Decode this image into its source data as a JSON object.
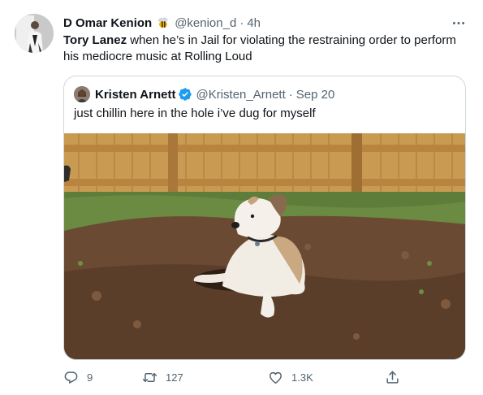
{
  "tweet": {
    "author_name": "D Omar Kenion",
    "author_handle": "@kenion_d",
    "separator": "·",
    "time": "4h",
    "text_bold": "Tory Lanez",
    "text_rest": " when he’s in Jail for violating the restraining order to perform his mediocre music at Rolling Loud",
    "icons": {
      "name_emoji": "bee-emoji-icon",
      "more": "more-icon"
    }
  },
  "quote": {
    "author_name": "Kristen Arnett",
    "author_handle": "@Kristen_Arnett",
    "separator": "·",
    "date": "Sep 20",
    "text": "just chillin here in the hole i’ve dug for myself",
    "verified": true,
    "image_subject": "dog-in-hole-photo"
  },
  "actions": {
    "replies": "9",
    "retweets": "127",
    "likes": "1.3K"
  },
  "colors": {
    "text_primary": "#0f1419",
    "text_secondary": "#536471",
    "border": "#cfd9de",
    "verified_blue": "#1d9bf0"
  }
}
